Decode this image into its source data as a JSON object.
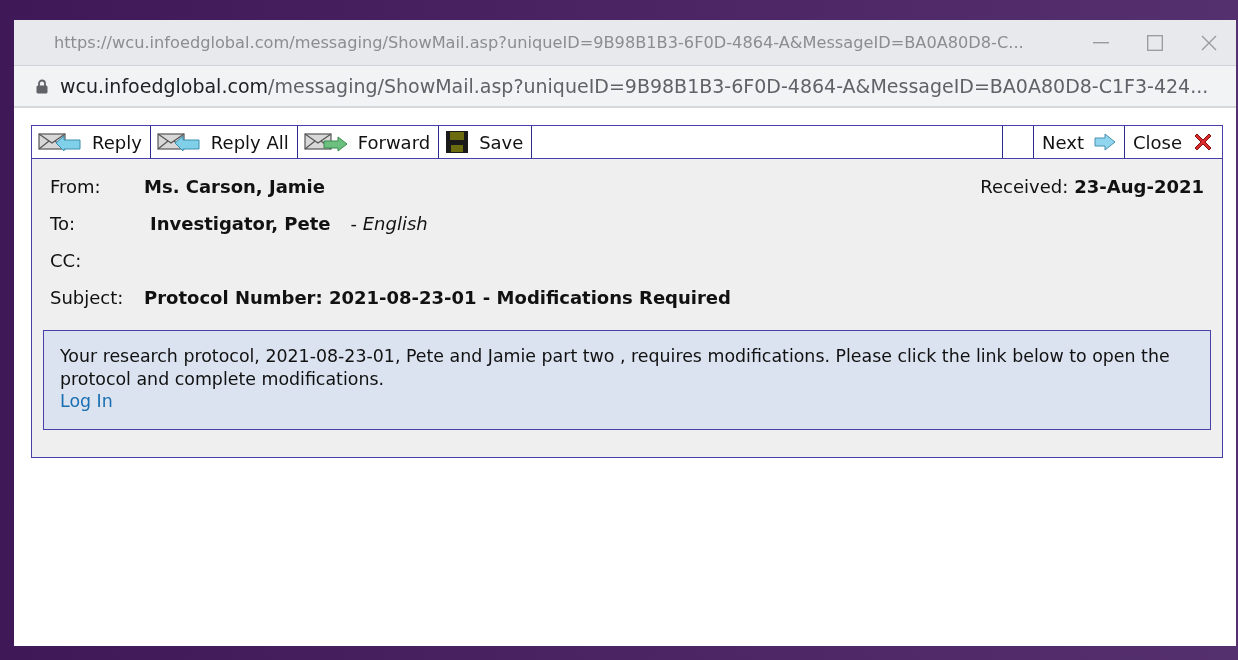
{
  "window": {
    "title": "https://wcu.infoedglobal.com/messaging/ShowMail.asp?uniqueID=9B98B1B3-6F0D-4864-A&MessageID=BA0A80D8-C..."
  },
  "address_bar": {
    "domain": "wcu.infoedglobal.com",
    "path": "/messaging/ShowMail.asp?uniqueID=9B98B1B3-6F0D-4864-A&MessageID=BA0A80D8-C1F3-424..."
  },
  "toolbar": {
    "left": [
      {
        "label": "Reply",
        "kind": "reply"
      },
      {
        "label": "Reply All",
        "kind": "reply-all"
      },
      {
        "label": "Forward",
        "kind": "forward"
      },
      {
        "label": "Save",
        "kind": "save"
      }
    ],
    "right": [
      {
        "label": "Next",
        "kind": "next"
      },
      {
        "label": "Close",
        "kind": "close"
      }
    ]
  },
  "header": {
    "from_label": "From:",
    "from": "Ms. Carson, Jamie",
    "received_label": "Received:",
    "received": "23-Aug-2021",
    "to_label": "To:",
    "to": "Investigator, Pete",
    "to_language": "- *English*",
    "cc_label": "CC:",
    "subject_label": "Subject:",
    "subject": "Protocol Number: 2021-08-23-01 - Modifications Required"
  },
  "body": {
    "text": "Your research protocol, 2021-08-23-01, Pete and Jamie part two , requires modifications. Please click the link below to open the protocol and complete modifications.",
    "link": "Log In"
  }
}
